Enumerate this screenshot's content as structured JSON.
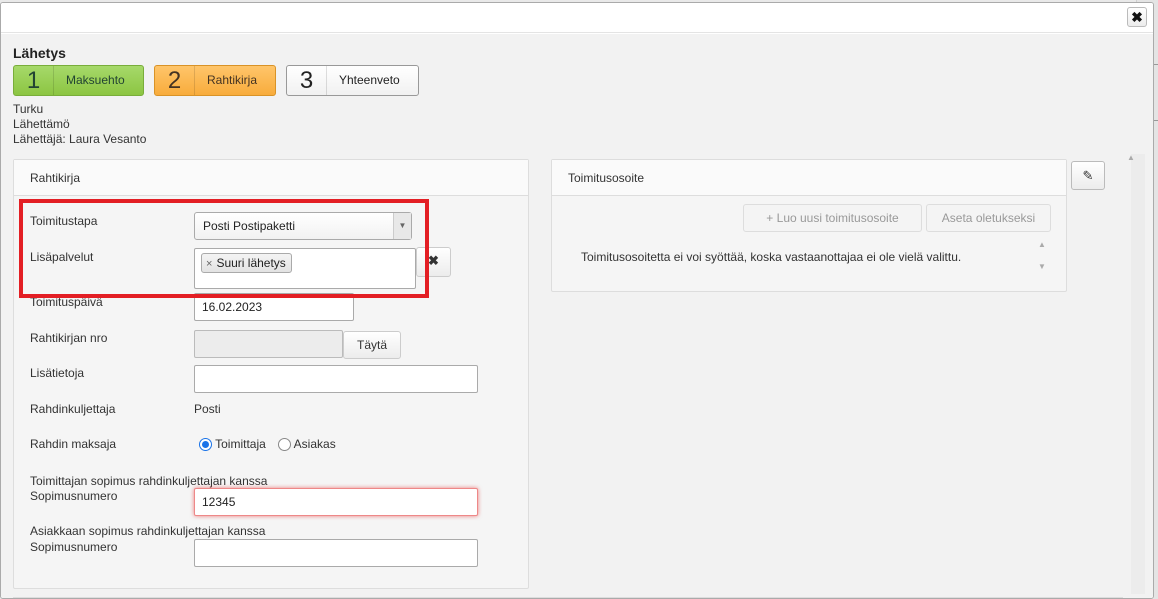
{
  "dialog": {
    "close_label": "✖",
    "heading": "Lähetys",
    "steps": [
      {
        "num": "1",
        "label": "Maksuehto"
      },
      {
        "num": "2",
        "label": "Rahtikirja"
      },
      {
        "num": "3",
        "label": "Yhteenveto"
      }
    ],
    "info": {
      "city": "Turku",
      "origin": "Lähettämö",
      "sender": "Lähettäjä: Laura Vesanto"
    }
  },
  "rahtikirja": {
    "title": "Rahtikirja",
    "toimitustapa_label": "Toimitustapa",
    "toimitustapa_value": "Posti Postipaketti",
    "lisapalvelut_label": "Lisäpalvelut",
    "lisapalvelut_chip": "Suuri lähetys",
    "chip_remove": "×",
    "clear_label": "✖",
    "toimituspaiva_label": "Toimituspäivä",
    "toimituspaiva_value": "16.02.2023",
    "rahtikirjan_nro_label": "Rahtikirjan nro",
    "rahtikirjan_nro_value": "",
    "tayta_label": "Täytä",
    "lisatietoja_label": "Lisätietoja",
    "lisatietoja_value": "",
    "rahdinkuljettaja_label": "Rahdinkuljettaja",
    "rahdinkuljettaja_value": "Posti",
    "rahdin_maksaja_label": "Rahdin maksaja",
    "maksaja_options": [
      "Toimittaja",
      "Asiakas"
    ],
    "maksaja_selected": "Toimittaja",
    "toimittajan_sopimus_label": "Toimittajan sopimus rahdinkuljettajan kanssa",
    "sopimusnumero_label": "Sopimusnumero",
    "toimittajan_sopimusnumero_value": "12345",
    "asiakkaan_sopimus_label": "Asiakkaan sopimus rahdinkuljettajan kanssa",
    "asiakkaan_sopimusnumero_label": "Sopimusnumero",
    "asiakkaan_sopimusnumero_value": ""
  },
  "toimitusosoite": {
    "title": "Toimitusosoite",
    "new_address_label": "Luo uusi toimitusosoite",
    "set_default_label": "Aseta oletukseksi",
    "message": "Toimitusosoitetta ei voi syöttää, koska vastaanottajaa ei ole vielä valittu.",
    "edit_icon": "✎"
  },
  "colors": {
    "step1": "#8cc542",
    "step2": "#f8ac3c",
    "highlight": "#e31e24",
    "radio": "#1a73e8"
  }
}
